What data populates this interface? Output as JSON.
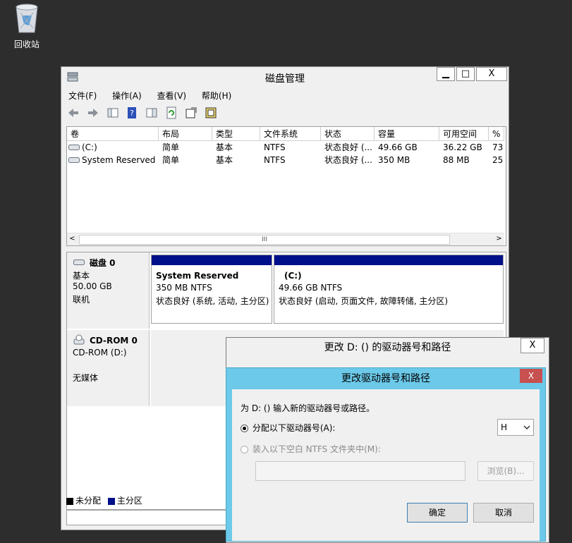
{
  "desktop": {
    "recycle_bin_label": "回收站"
  },
  "window": {
    "title": "磁盘管理",
    "minimize": "▁",
    "maximize": "□",
    "close": "X"
  },
  "menu": [
    "文件(F)",
    "操作(A)",
    "查看(V)",
    "帮助(H)"
  ],
  "volumes": {
    "headers": [
      "卷",
      "布局",
      "类型",
      "文件系统",
      "状态",
      "容量",
      "可用空间",
      "%"
    ],
    "rows": [
      [
        "(C:)",
        "简单",
        "基本",
        "NTFS",
        "状态良好 (...",
        "49.66 GB",
        "36.22 GB",
        "73"
      ],
      [
        "System Reserved",
        "简单",
        "基本",
        "NTFS",
        "状态良好 (...",
        "350 MB",
        "88 MB",
        "25"
      ]
    ],
    "scroll_grip": "III"
  },
  "disks": [
    {
      "name": "磁盘 0",
      "lines": [
        "基本",
        "50.00 GB",
        "联机"
      ],
      "partitions": [
        {
          "name": "System Reserved",
          "size": "350 MB NTFS",
          "status": "状态良好 (系统, 活动, 主分区)"
        },
        {
          "name": "(C:)",
          "size": "49.66 GB NTFS",
          "status": "状态良好 (启动, 页面文件, 故障转储, 主分区)"
        }
      ]
    },
    {
      "name": "CD-ROM 0",
      "lines": [
        "CD-ROM (D:)",
        "",
        "无媒体"
      ]
    }
  ],
  "legend": {
    "unallocated": "未分配",
    "primary": "主分区",
    "unallocated_color": "#000000",
    "primary_color": "#000f8a"
  },
  "back_dialog": {
    "title": "更改 D: () 的驱动器号和路径",
    "close": "X"
  },
  "dialog": {
    "title": "更改驱动器号和路径",
    "close": "X",
    "prompt": "为 D: () 输入新的驱动器号或路径。",
    "option_letter": "分配以下驱动器号(A):",
    "option_folder": "装入以下空白 NTFS 文件夹中(M):",
    "selected_letter": "H",
    "browse": "浏览(B)...",
    "ok": "确定",
    "cancel": "取消",
    "close_color": "#c75050",
    "title_color": "#6cc9e9"
  }
}
